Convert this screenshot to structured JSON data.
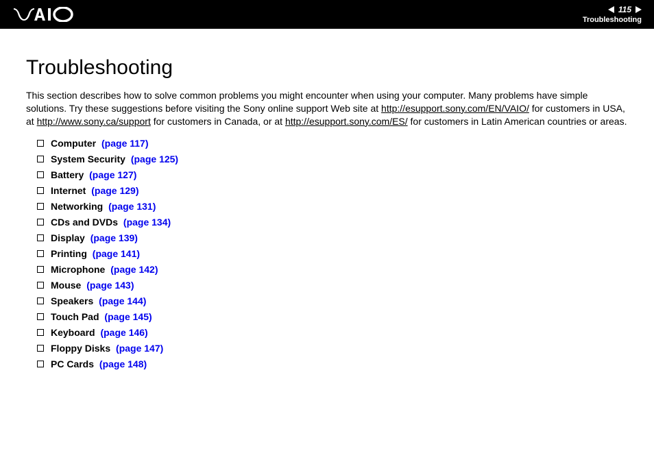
{
  "header": {
    "page_number": "115",
    "section": "Troubleshooting"
  },
  "main": {
    "title": "Troubleshooting",
    "intro": {
      "part1": "This section describes how to solve common problems you might encounter when using your computer. Many problems have simple solutions. Try these suggestions before visiting the Sony online support Web site at ",
      "link1": "http://esupport.sony.com/EN/VAIO/",
      "part2": " for customers in USA, at ",
      "link2": "http://www.sony.ca/support",
      "part3": " for customers in Canada, or at ",
      "link3": "http://esupport.sony.com/ES/",
      "part4": " for customers in Latin American countries or areas."
    },
    "toc": [
      {
        "label": "Computer",
        "page": "(page 117)"
      },
      {
        "label": "System Security",
        "page": "(page 125)"
      },
      {
        "label": "Battery",
        "page": "(page 127)"
      },
      {
        "label": "Internet",
        "page": "(page 129)"
      },
      {
        "label": "Networking",
        "page": "(page 131)"
      },
      {
        "label": "CDs and DVDs",
        "page": "(page 134)"
      },
      {
        "label": "Display",
        "page": "(page 139)"
      },
      {
        "label": "Printing",
        "page": "(page 141)"
      },
      {
        "label": "Microphone",
        "page": "(page 142)"
      },
      {
        "label": "Mouse",
        "page": "(page 143)"
      },
      {
        "label": "Speakers",
        "page": "(page 144)"
      },
      {
        "label": "Touch Pad",
        "page": "(page 145)"
      },
      {
        "label": "Keyboard",
        "page": "(page 146)"
      },
      {
        "label": "Floppy Disks",
        "page": "(page 147)"
      },
      {
        "label": "PC Cards",
        "page": "(page 148)"
      }
    ]
  }
}
